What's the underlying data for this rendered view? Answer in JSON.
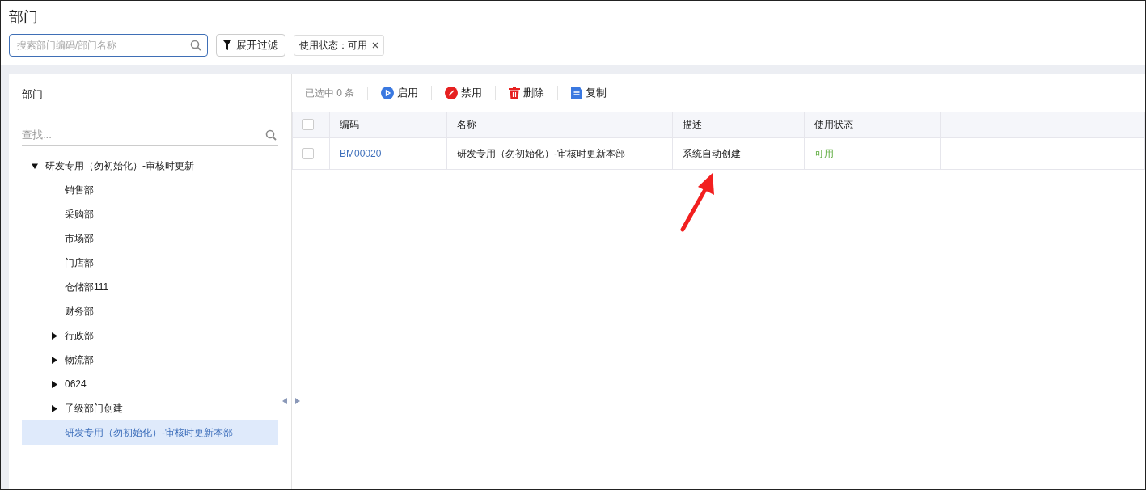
{
  "page_title": "部门",
  "search": {
    "placeholder": "搜索部门编码/部门名称"
  },
  "filter_button": "展开过滤",
  "filter_tags": [
    {
      "label": "使用状态：可用"
    }
  ],
  "tree_panel": {
    "title": "部门",
    "search_placeholder": "查找...",
    "items": [
      {
        "label": "研发专用（勿初始化）-审核时更新",
        "kind": "branch",
        "expanded": true,
        "selected": false,
        "children": [
          {
            "label": "销售部",
            "kind": "leaf",
            "expanded": false,
            "selected": false
          },
          {
            "label": "采购部",
            "kind": "leaf",
            "expanded": false,
            "selected": false
          },
          {
            "label": "市场部",
            "kind": "leaf",
            "expanded": false,
            "selected": false
          },
          {
            "label": "门店部",
            "kind": "leaf",
            "expanded": false,
            "selected": false
          },
          {
            "label": "仓储部111",
            "kind": "leaf",
            "expanded": false,
            "selected": false
          },
          {
            "label": "财务部",
            "kind": "leaf",
            "expanded": false,
            "selected": false
          },
          {
            "label": "行政部",
            "kind": "branch",
            "expanded": false,
            "selected": false
          },
          {
            "label": "物流部",
            "kind": "branch",
            "expanded": false,
            "selected": false
          },
          {
            "label": "0624",
            "kind": "branch",
            "expanded": false,
            "selected": false
          },
          {
            "label": "子级部门创建",
            "kind": "branch",
            "expanded": false,
            "selected": false
          },
          {
            "label": "研发专用（勿初始化）-审核时更新本部",
            "kind": "leaf",
            "expanded": false,
            "selected": true
          }
        ]
      }
    ]
  },
  "toolbar": {
    "selection_count": "已选中 0 条",
    "actions": [
      {
        "label": "启用",
        "kind": "enable"
      },
      {
        "label": "禁用",
        "kind": "disable"
      },
      {
        "label": "删除",
        "kind": "delete"
      },
      {
        "label": "复制",
        "kind": "copy"
      }
    ]
  },
  "table": {
    "select_all": {
      "checked": false
    },
    "columns": [
      "编码",
      "名称",
      "描述",
      "使用状态"
    ],
    "rows": [
      {
        "selected": false,
        "code": "BM00020",
        "name": "研发专用（勿初始化）-审核时更新本部",
        "description": "系统自动创建",
        "status": "可用"
      }
    ]
  }
}
